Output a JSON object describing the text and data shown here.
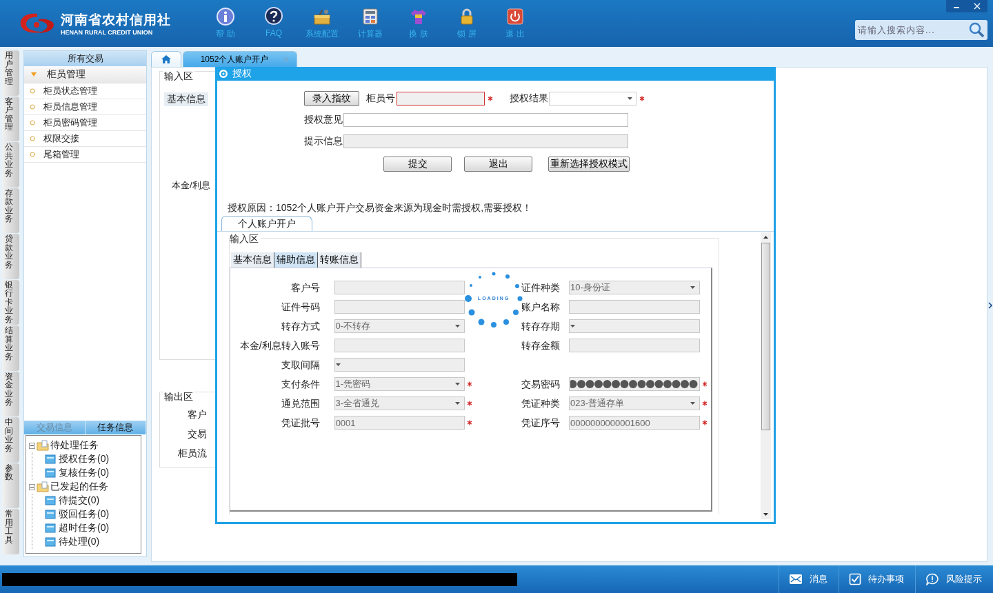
{
  "header": {
    "logo_title": "河南省农村信用社",
    "logo_subtitle": "HENAN RURAL CREDIT UNION",
    "toolbar": [
      {
        "label": "帮 助",
        "kind": "help"
      },
      {
        "label": "FAQ",
        "kind": "faq"
      },
      {
        "label": "系统配置",
        "kind": "settings"
      },
      {
        "label": "计算器",
        "kind": "calculator"
      },
      {
        "label": "换 肤",
        "kind": "skin"
      },
      {
        "label": "锁 屏",
        "kind": "lock"
      },
      {
        "label": "退 出",
        "kind": "exit"
      }
    ],
    "search": {
      "placeholder": "请输入搜索内容..."
    }
  },
  "nav_tabs": [
    "用户管理",
    "客户管理",
    "公共业务",
    "存款业务",
    "贷款业务",
    "银行卡业务",
    "结算业务",
    "资金业务",
    "中间业务",
    "参数",
    "常用工具"
  ],
  "sidebar": {
    "title": "所有交易",
    "group": {
      "label": "柜员管理",
      "expanded": true,
      "items": [
        "柜员状态管理",
        "柜员信息管理",
        "柜员密码管理",
        "权限交接",
        "尾箱管理"
      ]
    },
    "bottom_tabs": [
      {
        "label": "交易信息",
        "selected": false
      },
      {
        "label": "任务信息",
        "selected": true
      }
    ],
    "tree": [
      {
        "label": "待处理任务",
        "expanded": true,
        "children": [
          {
            "label": "授权任务(0)"
          },
          {
            "label": "复核任务(0)"
          }
        ]
      },
      {
        "label": "已发起的任务",
        "expanded": true,
        "children": [
          {
            "label": "待提交(0)"
          },
          {
            "label": "驳回任务(0)"
          },
          {
            "label": "超时任务(0)"
          },
          {
            "label": "待处理(0)"
          }
        ]
      }
    ]
  },
  "tabs": [
    {
      "kind": "home",
      "selected": false
    },
    {
      "kind": "text",
      "label": "1052个人账户开户",
      "selected": true,
      "closable": true
    }
  ],
  "background_form": {
    "input_legend": "输入区",
    "tab": "基本信息",
    "field_label": "本金/利息",
    "output_legend": "输出区",
    "output_labels": [
      "客户",
      "交易",
      "柜员流"
    ]
  },
  "dialog": {
    "title": "授权",
    "fingerprint_button": "录入指纹",
    "teller": {
      "label": "柜员号",
      "invalid": true,
      "required": true
    },
    "result": {
      "label": "授权结果",
      "required": true
    },
    "opinion": {
      "label": "授权意见"
    },
    "hint": {
      "label": "提示信息",
      "disabled": true
    },
    "buttons": [
      "提交",
      "退出",
      "重新选择授权模式"
    ],
    "reason": "授权原因：1052个人账户开户交易资金来源为现金时需授权,需要授权！",
    "tab": "个人账户开户",
    "form": {
      "legend": "输入区",
      "loading": "LOADING",
      "tabs": [
        {
          "label": "基本信息",
          "selected": false
        },
        {
          "label": "辅助信息",
          "selected": true
        },
        {
          "label": "转账信息",
          "selected": false
        }
      ],
      "rows": [
        {
          "left": {
            "label": "客户号",
            "kind": "text",
            "required": false
          },
          "right": {
            "label": "证件种类",
            "kind": "select",
            "value": "10-身份证",
            "required": false
          }
        },
        {
          "left": {
            "label": "证件号码",
            "kind": "text",
            "required": false
          },
          "right": {
            "label": "账户名称",
            "kind": "text",
            "required": false
          }
        },
        {
          "left": {
            "label": "转存方式",
            "kind": "select",
            "value": "0-不转存",
            "required": false
          },
          "right": {
            "label": "转存存期",
            "kind": "select",
            "required": false
          }
        },
        {
          "left": {
            "label": "本金/利息转入账号",
            "kind": "text",
            "required": false
          },
          "right": {
            "label": "转存金额",
            "kind": "text",
            "required": false
          }
        },
        {
          "left": {
            "label": "支取间隔",
            "kind": "select",
            "required": false
          }
        },
        {
          "left": {
            "label": "支付条件",
            "kind": "select",
            "value": "1-凭密码",
            "required": true
          },
          "right": {
            "label": "交易密码",
            "kind": "password",
            "required": true
          }
        },
        {
          "left": {
            "label": "通兑范围",
            "kind": "select",
            "value": "3-全省通兑",
            "required": true
          },
          "right": {
            "label": "凭证种类",
            "kind": "select",
            "value": "023-普通存单",
            "required": true
          }
        },
        {
          "left": {
            "label": "凭证批号",
            "kind": "text",
            "value": "0001",
            "required": true
          },
          "right": {
            "label": "凭证序号",
            "kind": "text",
            "value": "0000000000001600",
            "required": true
          }
        }
      ]
    }
  },
  "status_bar": {
    "buttons": [
      {
        "label": "消息",
        "kind": "message"
      },
      {
        "label": "待办事项",
        "kind": "todo"
      },
      {
        "label": "风险提示",
        "kind": "risk"
      }
    ]
  }
}
